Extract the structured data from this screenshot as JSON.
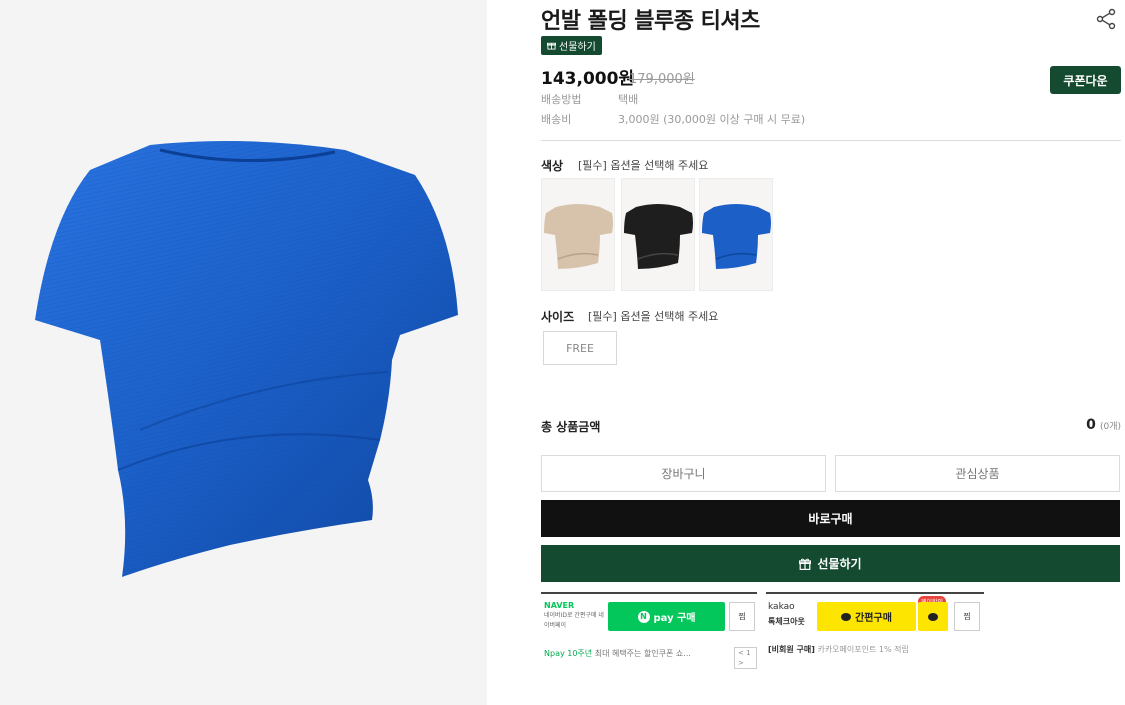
{
  "product": {
    "title": "언발 폴딩 블루종 티셔츠",
    "gift_badge": "선물하기",
    "price": "143,000원",
    "original_price": "179,000원",
    "coupon_button": "쿠폰다운",
    "main_color": "#1b5fc7",
    "brand_green": "#134a30"
  },
  "shipping": {
    "method_label": "배송방법",
    "method_value": "택배",
    "fee_label": "배송비",
    "fee_value": "3,000원 (30,000원 이상 구매 시 무료)"
  },
  "options": {
    "color_label": "색상",
    "color_hint": "[필수] 옵션을 선택해 주세요",
    "swatches": [
      {
        "name": "beige",
        "color": "#d7c3ac"
      },
      {
        "name": "black",
        "color": "#1e1e1e"
      },
      {
        "name": "blue",
        "color": "#1b5fc7"
      }
    ],
    "size_label": "사이즈",
    "size_hint": "[필수] 옵션을 선택해 주세요",
    "size_value": "FREE"
  },
  "total": {
    "label": "총 상품금액",
    "value": "0",
    "count": "(0개)"
  },
  "actions": {
    "cart": "장바구니",
    "wishlist": "관심상품",
    "buy_now": "바로구매",
    "gift": "선물하기"
  },
  "naver": {
    "logo": "NAVER",
    "sub": "네이버ID로 간편구매 네이버페이",
    "button": "pay 구매",
    "wish": "찜",
    "note_green": "Npay 10주년",
    "note_gray": "최대 혜택주는 할인쿠폰 쇼...",
    "pager": "< 1 >"
  },
  "kakao": {
    "logo": "kakao",
    "sub": "톡체크아웃",
    "button": "간편구매",
    "badge": "페이할인",
    "wish": "찜",
    "note_bold": "[비회원 구매]",
    "note_gray": "카카오페이포인트 1% 적립"
  }
}
